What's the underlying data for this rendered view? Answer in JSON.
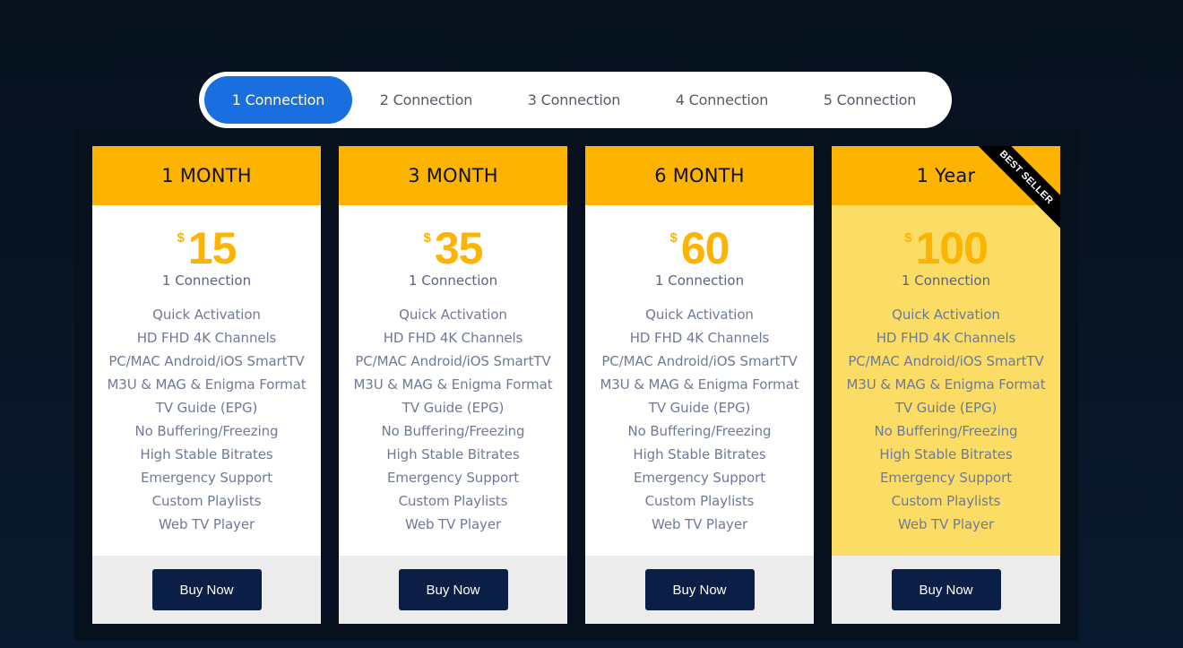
{
  "tabs": [
    {
      "label": "1 Connection",
      "active": true
    },
    {
      "label": "2 Connection",
      "active": false
    },
    {
      "label": "3 Connection",
      "active": false
    },
    {
      "label": "4 Connection",
      "active": false
    },
    {
      "label": "5 Connection",
      "active": false
    }
  ],
  "currency": "$",
  "buy_label": "Buy Now",
  "ribbon_label": "BEST SELLER",
  "connection_label": "1 Connection",
  "features": [
    "Quick Activation",
    "HD FHD 4K Channels",
    "PC/MAC Android/iOS SmartTV",
    "M3U & MAG & Enigma Format",
    "TV Guide (EPG)",
    "No Buffering/Freezing",
    "High Stable Bitrates",
    "Emergency Support",
    "Custom Playlists",
    "Web TV Player"
  ],
  "plans": [
    {
      "title": "1 MONTH",
      "price": "15"
    },
    {
      "title": "3 MONTH",
      "price": "35"
    },
    {
      "title": "6 MONTH",
      "price": "60"
    },
    {
      "title": "1 Year",
      "price": "100"
    }
  ],
  "colors": {
    "accent_blue": "#1a6fe0",
    "header_yellow": "#fcb400",
    "featured_bg": "#fbdc65",
    "button_navy": "#0b1f46"
  }
}
